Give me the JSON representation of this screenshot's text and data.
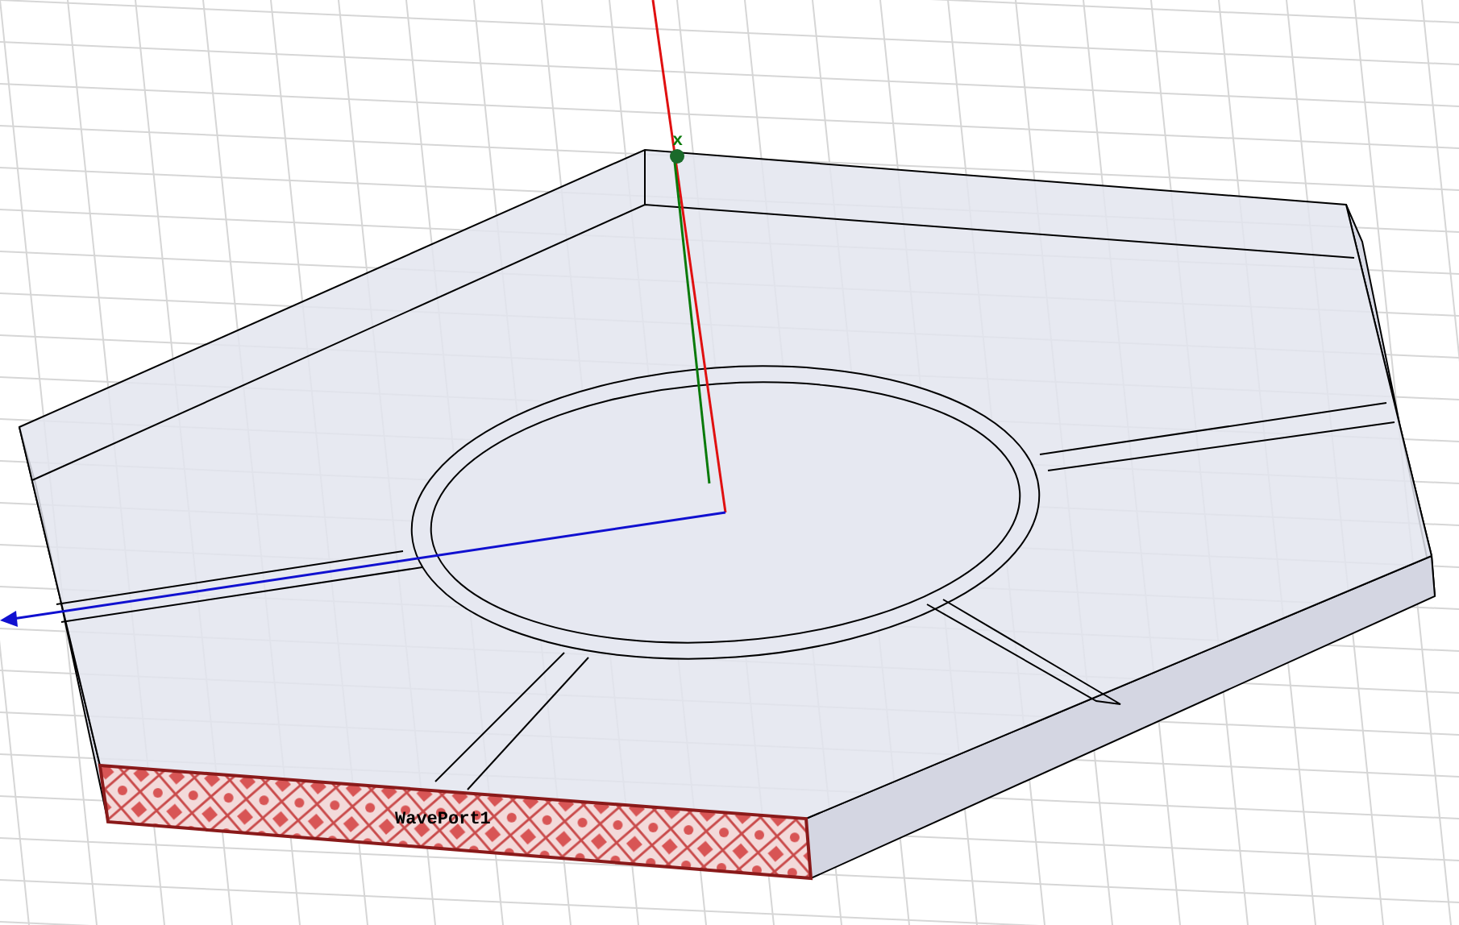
{
  "viewport": {
    "origin_label": "x",
    "port_label": "WavePort1"
  }
}
